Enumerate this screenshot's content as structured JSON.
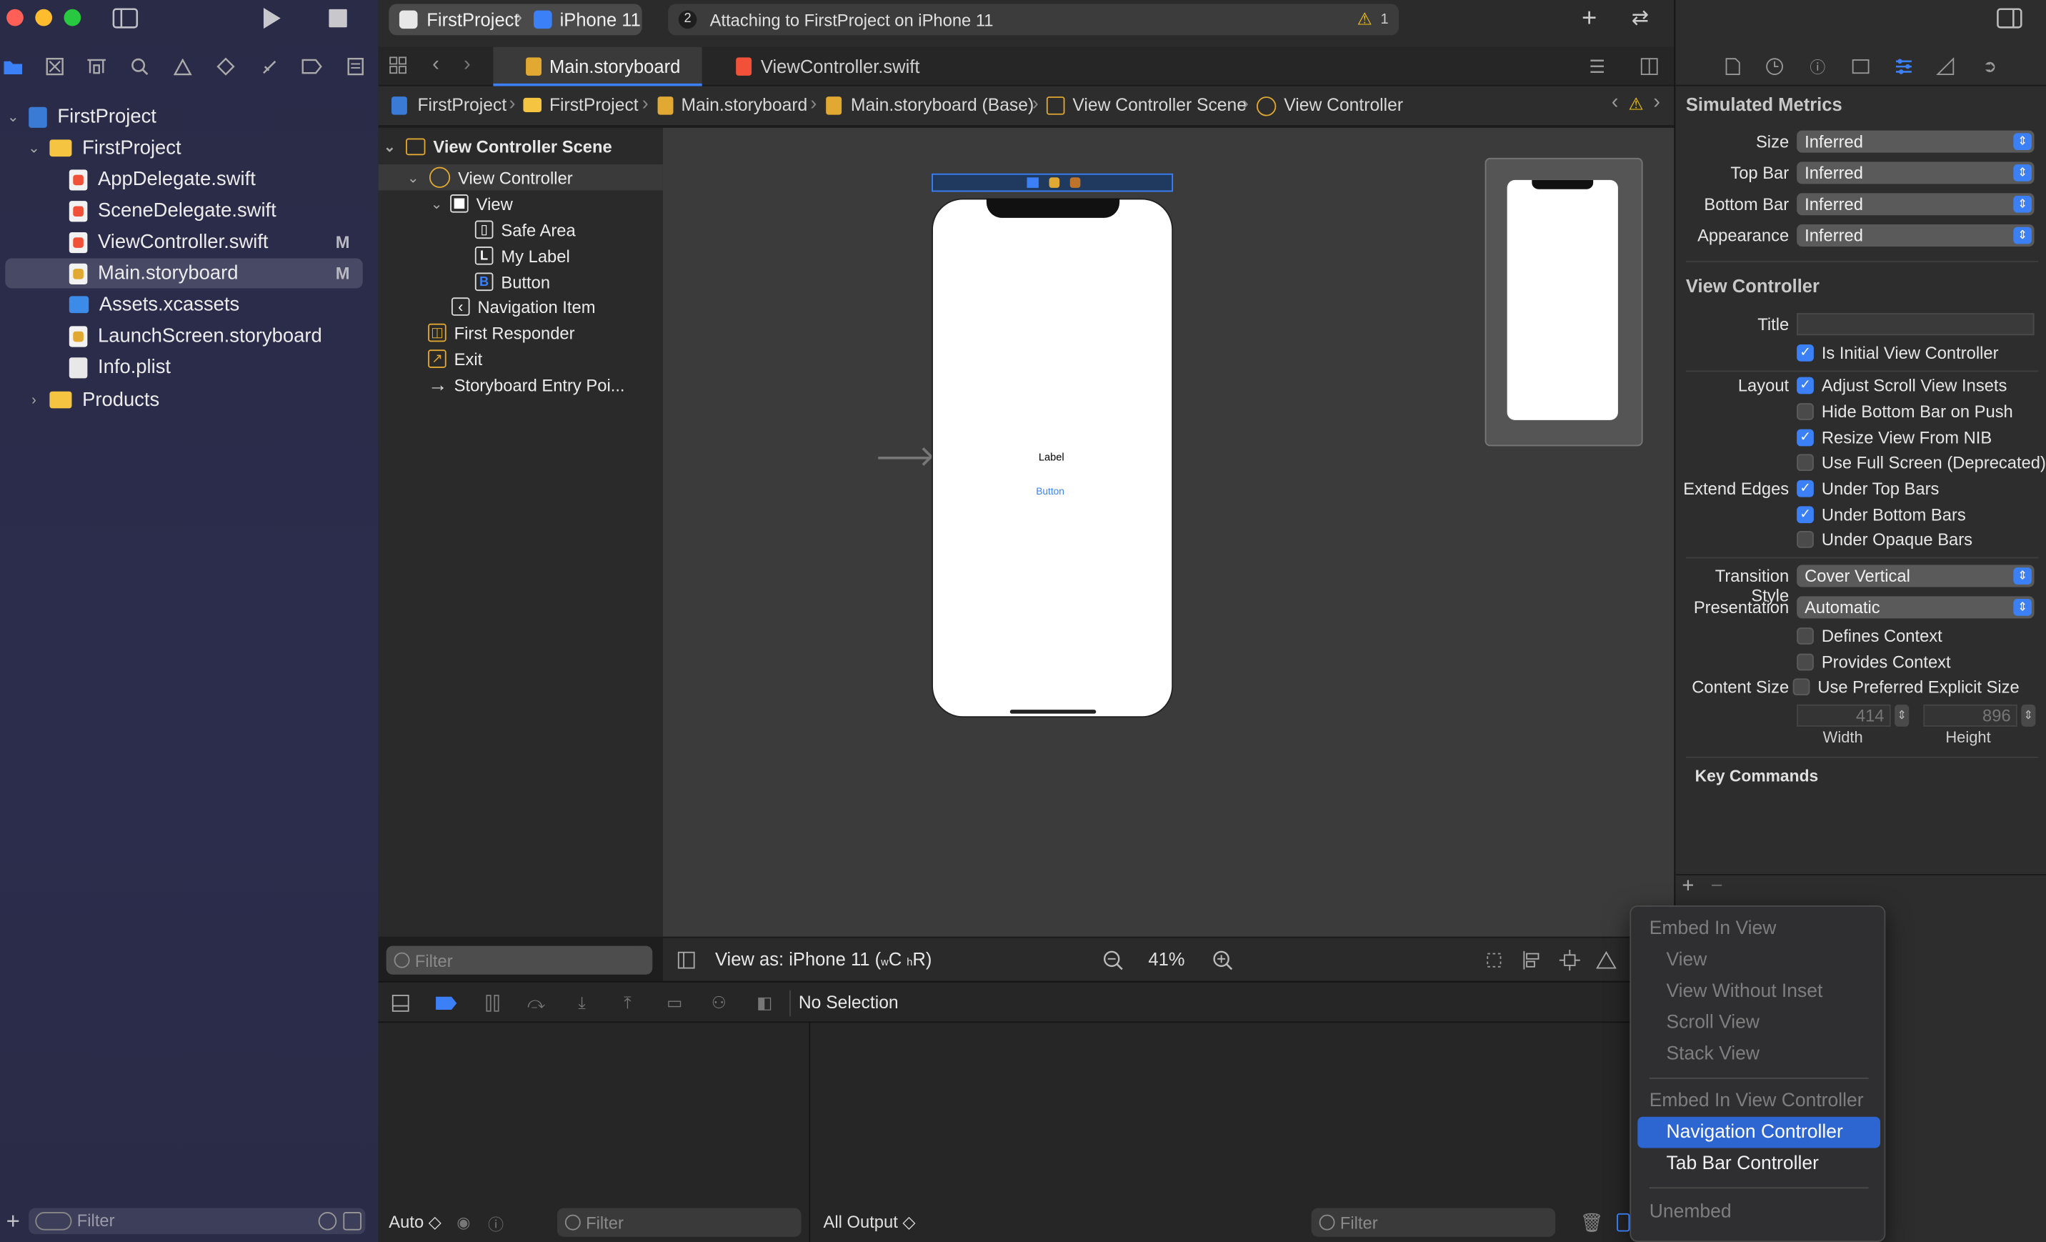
{
  "toolbar": {
    "scheme": "FirstProject",
    "device": "iPhone 11",
    "activity_count": "2",
    "activity_text": "Attaching to FirstProject on iPhone 11",
    "warning_count": "1"
  },
  "navigator": {
    "root": "FirstProject",
    "group": "FirstProject",
    "files": [
      {
        "name": "AppDelegate.swift",
        "badge": ""
      },
      {
        "name": "SceneDelegate.swift",
        "badge": ""
      },
      {
        "name": "ViewController.swift",
        "badge": "M"
      },
      {
        "name": "Main.storyboard",
        "badge": "M"
      },
      {
        "name": "Assets.xcassets",
        "badge": ""
      },
      {
        "name": "LaunchScreen.storyboard",
        "badge": ""
      },
      {
        "name": "Info.plist",
        "badge": ""
      }
    ],
    "products": "Products",
    "filter_placeholder": "Filter"
  },
  "tabs": [
    "Main.storyboard",
    "ViewController.swift"
  ],
  "breadcrumb": [
    "FirstProject",
    "FirstProject",
    "Main.storyboard",
    "Main.storyboard (Base)",
    "View Controller Scene",
    "View Controller"
  ],
  "outline": {
    "scene": "View Controller Scene",
    "vc": "View Controller",
    "view": "View",
    "safe_area": "Safe Area",
    "my_label": "My Label",
    "button": "Button",
    "nav_item": "Navigation Item",
    "first_responder": "First Responder",
    "exit": "Exit",
    "entry": "Storyboard Entry Poi...",
    "filter_placeholder": "Filter"
  },
  "canvas": {
    "label_text": "Label",
    "button_text": "Button",
    "view_as": "View as: iPhone 11 (",
    "view_as_w": "w",
    "view_as_c": "C",
    "view_as_h": "h",
    "view_as_r": "R)",
    "zoom": "41%"
  },
  "debug": {
    "no_selection": "No Selection",
    "auto": "Auto ◇",
    "filter_placeholder": "Filter",
    "all_output": "All Output ◇",
    "filter2_placeholder": "Filter"
  },
  "inspector": {
    "simulated_metrics": "Simulated Metrics",
    "size_label": "Size",
    "size_value": "Inferred",
    "topbar_label": "Top Bar",
    "topbar_value": "Inferred",
    "bottombar_label": "Bottom Bar",
    "bottombar_value": "Inferred",
    "appearance_label": "Appearance",
    "appearance_value": "Inferred",
    "vc_header": "View Controller",
    "title_label": "Title",
    "is_initial": "Is Initial View Controller",
    "layout_label": "Layout",
    "adjust_scroll": "Adjust Scroll View Insets",
    "hide_bottom": "Hide Bottom Bar on Push",
    "resize_nib": "Resize View From NIB",
    "full_screen": "Use Full Screen (Deprecated)",
    "extend_label": "Extend Edges",
    "under_top": "Under Top Bars",
    "under_bottom": "Under Bottom Bars",
    "under_opaque": "Under Opaque Bars",
    "transition_label": "Transition Style",
    "transition_value": "Cover Vertical",
    "presentation_label": "Presentation",
    "presentation_value": "Automatic",
    "defines_context": "Defines Context",
    "provides_context": "Provides Context",
    "content_size_label": "Content Size",
    "preferred_size": "Use Preferred Explicit Size",
    "width_value": "414",
    "height_value": "896",
    "width_label": "Width",
    "height_label": "Height",
    "key_commands": "Key Commands"
  },
  "embed_menu": {
    "header1": "Embed In View",
    "items1": [
      "View",
      "View Without Inset",
      "Scroll View",
      "Stack View"
    ],
    "header2": "Embed In View Controller",
    "nav_controller": "Navigation Controller",
    "tab_controller": "Tab Bar Controller",
    "unembed": "Unembed"
  },
  "colors": {
    "accent": "#3b80f6",
    "highlight": "#2e66d1",
    "warning": "#f5c518"
  }
}
